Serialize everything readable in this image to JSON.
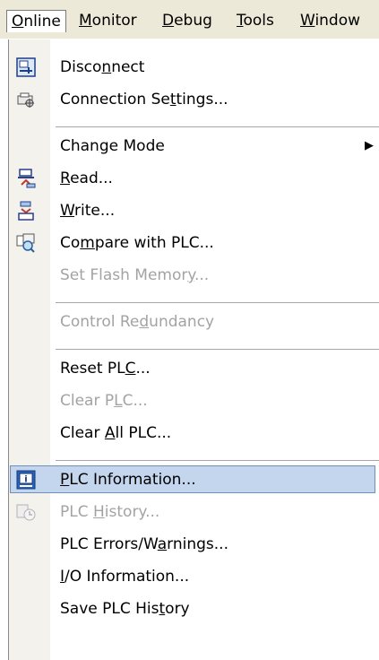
{
  "menubar": [
    {
      "pre": "",
      "u": "O",
      "post": "nline"
    },
    {
      "pre": "",
      "u": "M",
      "post": "onitor"
    },
    {
      "pre": "",
      "u": "D",
      "post": "ebug"
    },
    {
      "pre": "",
      "u": "T",
      "post": "ools"
    },
    {
      "pre": "",
      "u": "W",
      "post": "indow"
    }
  ],
  "menu": {
    "disconnect": {
      "pre": "Disco",
      "u": "n",
      "post": "nect"
    },
    "connection_settings": {
      "pre": "Connection Se",
      "u": "t",
      "post": "tings..."
    },
    "change_mode": {
      "pre": "Chan",
      "u": "g",
      "post": "e Mode"
    },
    "read": {
      "pre": "",
      "u": "R",
      "post": "ead..."
    },
    "write": {
      "pre": "",
      "u": "W",
      "post": "rite..."
    },
    "compare": {
      "pre": "Co",
      "u": "m",
      "post": "pare with PLC..."
    },
    "set_flash": {
      "pre": "Set Flash Memor",
      "u": "y",
      "post": "..."
    },
    "control_redundancy": {
      "pre": "Control Re",
      "u": "d",
      "post": "undancy"
    },
    "reset_plc": {
      "pre": "Reset PL",
      "u": "C",
      "post": "..."
    },
    "clear_plc": {
      "pre": "Clear P",
      "u": "L",
      "post": "C..."
    },
    "clear_all_plc": {
      "pre": "Clear ",
      "u": "A",
      "post": "ll PLC..."
    },
    "plc_information": {
      "pre": "",
      "u": "P",
      "post": "LC Information..."
    },
    "plc_history": {
      "pre": "PLC ",
      "u": "H",
      "post": "istory..."
    },
    "plc_errors": {
      "pre": "PLC Errors/W",
      "u": "a",
      "post": "rnings..."
    },
    "io_information": {
      "pre": "",
      "u": "I",
      "post": "/O Information..."
    },
    "save_plc_history": {
      "pre": "Save PLC His",
      "u": "t",
      "post": "ory"
    }
  }
}
